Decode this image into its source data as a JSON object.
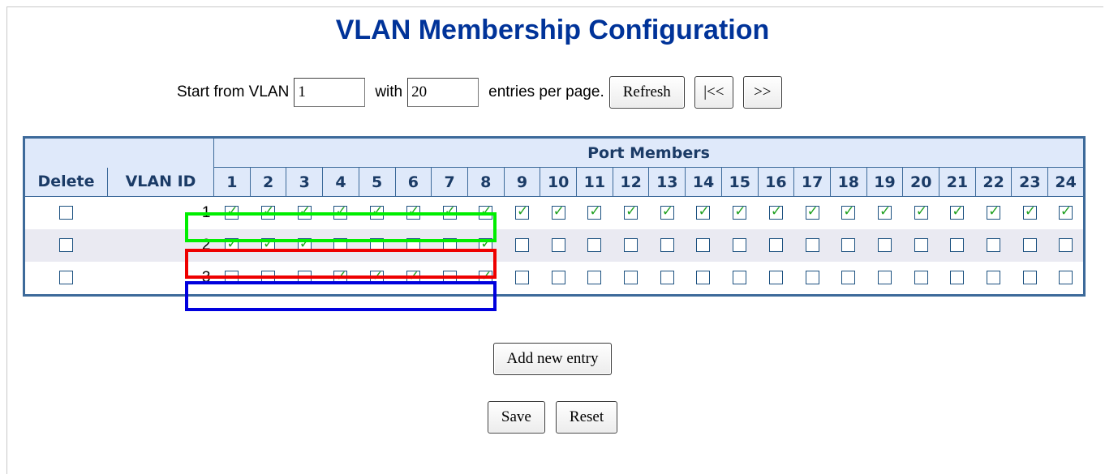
{
  "title": "VLAN Membership Configuration",
  "controls": {
    "start_label": "Start from VLAN",
    "start_value": "1",
    "with_label": "with",
    "entries_value": "20",
    "entries_label": "entries per page.",
    "refresh_label": "Refresh",
    "first_label": "|<<",
    "next_label": ">>"
  },
  "table": {
    "port_members_header": "Port Members",
    "delete_header": "Delete",
    "vlan_id_header": "VLAN ID",
    "ports": [
      "1",
      "2",
      "3",
      "4",
      "5",
      "6",
      "7",
      "8",
      "9",
      "10",
      "11",
      "12",
      "13",
      "14",
      "15",
      "16",
      "17",
      "18",
      "19",
      "20",
      "21",
      "22",
      "23",
      "24"
    ],
    "rows": [
      {
        "vlan_id": "1",
        "delete": false,
        "members": [
          true,
          true,
          true,
          true,
          true,
          true,
          true,
          true,
          true,
          true,
          true,
          true,
          true,
          true,
          true,
          true,
          true,
          true,
          true,
          true,
          true,
          true,
          true,
          true
        ]
      },
      {
        "vlan_id": "2",
        "delete": false,
        "members": [
          true,
          true,
          true,
          false,
          false,
          false,
          false,
          true,
          false,
          false,
          false,
          false,
          false,
          false,
          false,
          false,
          false,
          false,
          false,
          false,
          false,
          false,
          false,
          false
        ]
      },
      {
        "vlan_id": "3",
        "delete": false,
        "members": [
          false,
          false,
          false,
          true,
          true,
          true,
          false,
          true,
          false,
          false,
          false,
          false,
          false,
          false,
          false,
          false,
          false,
          false,
          false,
          false,
          false,
          false,
          false,
          false
        ]
      }
    ],
    "highlight_colors": [
      "#00ee00",
      "#ee0000",
      "#0000dd"
    ]
  },
  "buttons": {
    "add_new_entry": "Add new entry",
    "save": "Save",
    "reset": "Reset"
  }
}
